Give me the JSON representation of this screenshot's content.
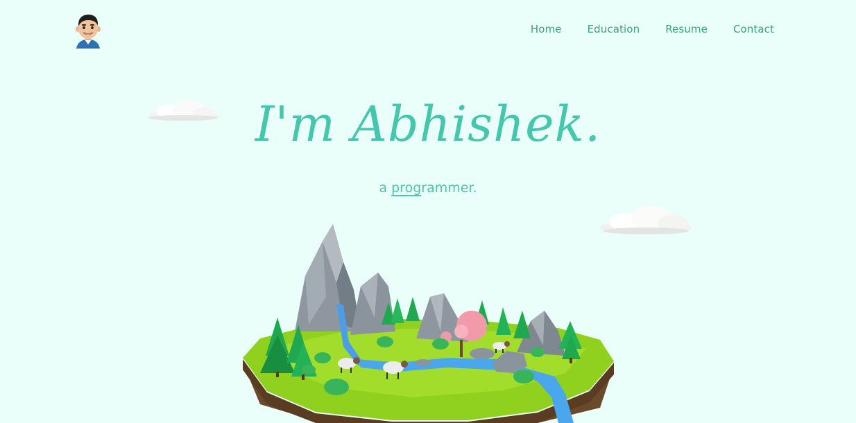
{
  "nav": {
    "items": [
      {
        "label": "Home"
      },
      {
        "label": "Education"
      },
      {
        "label": "Resume"
      },
      {
        "label": "Contact"
      }
    ]
  },
  "hero": {
    "title": "I'm Abhishek.",
    "subtitle_prefix": "a ",
    "subtitle_highlight": "prog",
    "subtitle_rest": "rammer."
  },
  "colors": {
    "background": "#eafffa",
    "nav_text": "#3aa378",
    "title": "#44c7ad",
    "subtitle": "#4ec6aa"
  },
  "icons": {
    "avatar": "bitmoji-avatar",
    "clouds": "cloud-icon",
    "illustration": "floating-island"
  }
}
